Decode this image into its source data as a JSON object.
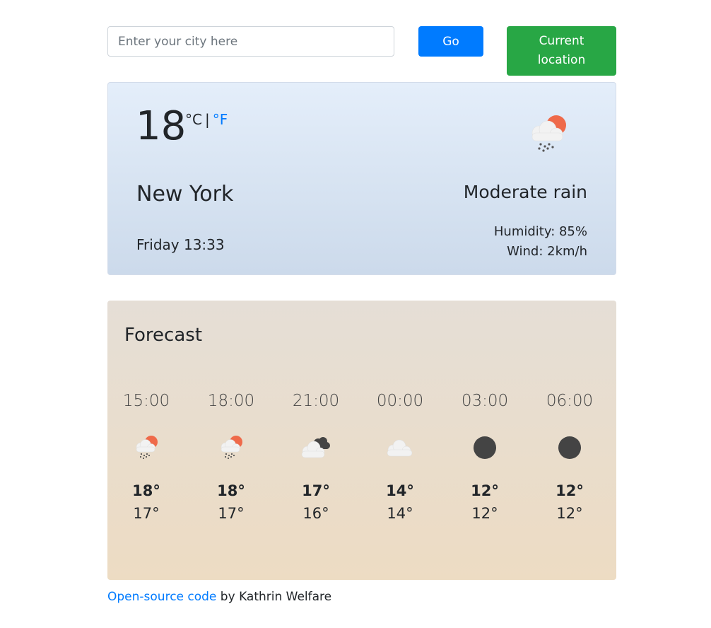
{
  "search": {
    "placeholder": "Enter your city here",
    "go_label": "Go",
    "current_location_label": "Current location"
  },
  "current": {
    "temperature": "18",
    "unit_celsius": "°C",
    "unit_separator": "|",
    "unit_fahrenheit": "°F",
    "city": "New York",
    "description": "Moderate rain",
    "datetime": "Friday 13:33",
    "humidity": "Humidity: 85%",
    "wind": "Wind: 2km/h",
    "icon": "sun-cloud-rain-icon"
  },
  "forecast": {
    "title": "Forecast",
    "items": [
      {
        "time": "15:00",
        "max": "18°",
        "min": "17°",
        "icon": "sun-cloud-rain-icon"
      },
      {
        "time": "18:00",
        "max": "18°",
        "min": "17°",
        "icon": "sun-cloud-rain-icon"
      },
      {
        "time": "21:00",
        "max": "17°",
        "min": "16°",
        "icon": "dark-clouds-icon"
      },
      {
        "time": "00:00",
        "max": "14°",
        "min": "14°",
        "icon": "cloud-icon"
      },
      {
        "time": "03:00",
        "max": "12°",
        "min": "12°",
        "icon": "moon-icon"
      },
      {
        "time": "06:00",
        "max": "12°",
        "min": "12°",
        "icon": "moon-icon"
      }
    ]
  },
  "footer": {
    "link_text": "Open-source code",
    "suffix": " by Kathrin Welfare"
  },
  "colors": {
    "primary": "#007bff",
    "success": "#28a745",
    "sun": "#ef6a4a",
    "cloud": "#f2f2f2",
    "dark": "#444444"
  }
}
